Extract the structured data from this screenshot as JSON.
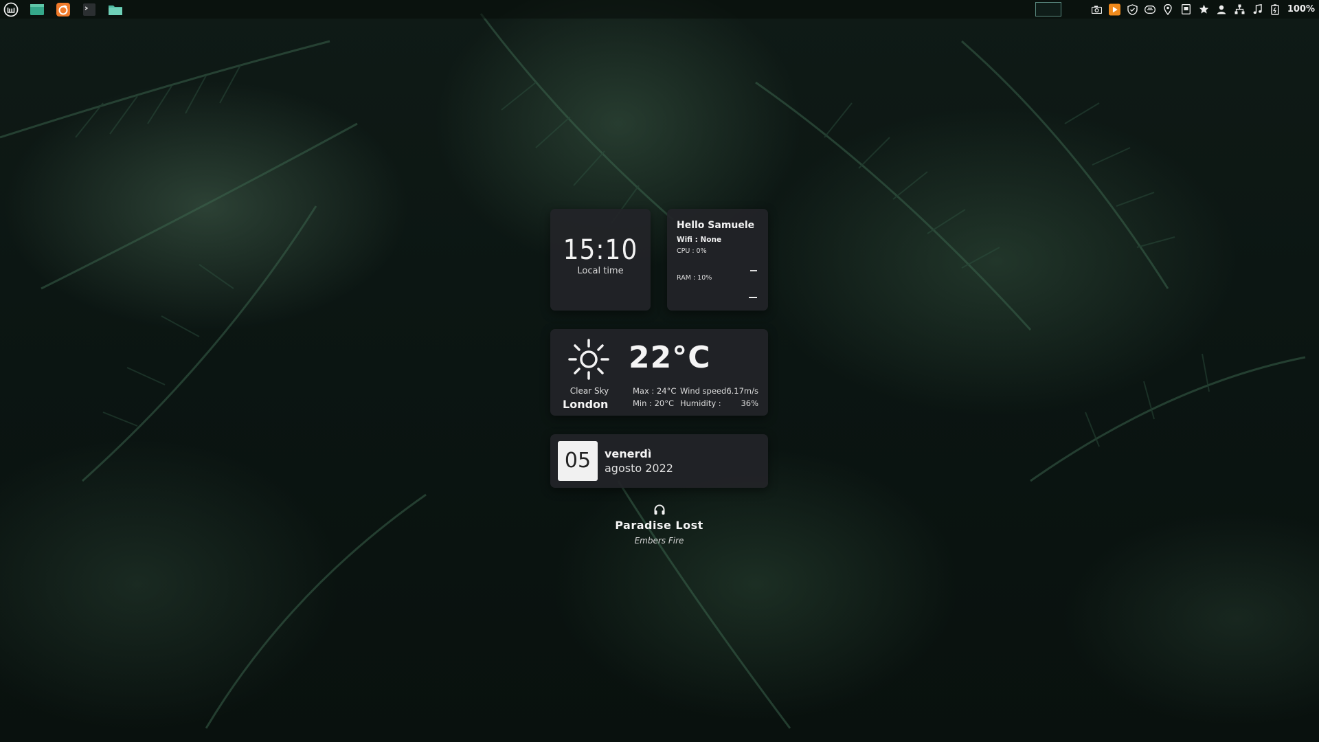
{
  "panel": {
    "battery": "100%",
    "launchers": [
      "menu-icon",
      "files-icon",
      "firefox-icon",
      "terminal-icon",
      "folder-icon"
    ],
    "tray": [
      "camera-icon",
      "media-player-icon",
      "shield-icon",
      "wifi-card-icon",
      "location-icon",
      "clipboard-icon",
      "star-icon",
      "user-icon",
      "network-icon",
      "music-icon",
      "battery-icon"
    ]
  },
  "clock": {
    "time": "15:10",
    "label": "Local time"
  },
  "system": {
    "greeting": "Hello Samuele",
    "wifi": "Wifi :  None",
    "cpu": "CPU : 0%",
    "ram": "RAM : 10%",
    "cpu_percent": 0,
    "ram_percent": 10
  },
  "weather": {
    "temperature": "22°C",
    "condition": "Clear Sky",
    "city": "London",
    "max": "Max : 24°C",
    "min": "Min :  20°C",
    "wind_label": "Wind speed :",
    "wind_value": "6.17m/s",
    "humidity_label": "Humidity :",
    "humidity_value": "36%"
  },
  "date": {
    "day": "05",
    "weekday": "venerdì",
    "month_year": "agosto 2022"
  },
  "music": {
    "song": "Paradise Lost",
    "artist": "Embers Fire"
  },
  "colors": {
    "accent": "#5a8a80",
    "card": "#222428"
  }
}
